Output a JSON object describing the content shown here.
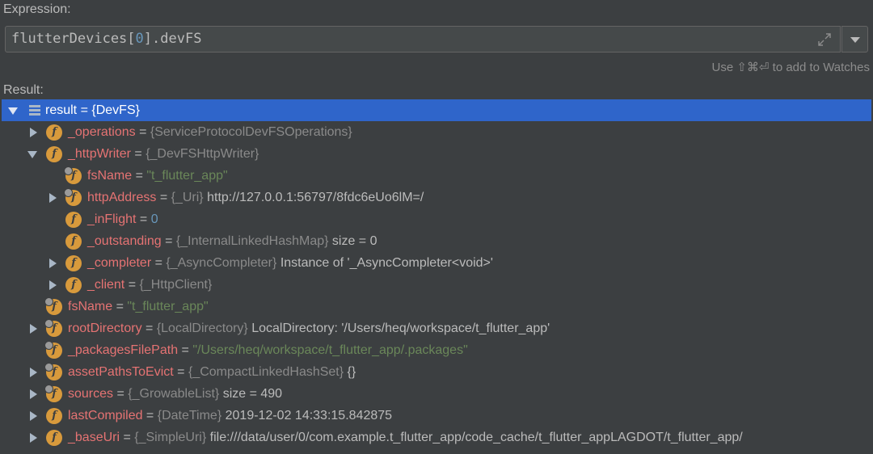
{
  "expression": {
    "label": "Expression:",
    "prefix": "flutterDevices[",
    "index": "0",
    "suffix": "].devFS",
    "hint": "Use ⇧⌘⏎ to add to Watches"
  },
  "result": {
    "label": "Result:",
    "rows": [
      {
        "indent": 0,
        "toggle": "expanded",
        "icon": "list",
        "name": "result",
        "type": "",
        "value": "= {DevFS}",
        "vclass": "val",
        "selected": true
      },
      {
        "indent": 1,
        "toggle": "collapsed",
        "icon": "field",
        "name": "_operations",
        "type": "{ServiceProtocolDevFSOperations}",
        "value": "",
        "vclass": "val"
      },
      {
        "indent": 1,
        "toggle": "expanded",
        "icon": "field",
        "name": "_httpWriter",
        "type": "{_DevFSHttpWriter}",
        "value": "",
        "vclass": "val"
      },
      {
        "indent": 2,
        "toggle": "none",
        "icon": "field-final",
        "name": "fsName",
        "type": "",
        "value": "\"t_flutter_app\"",
        "vclass": "str"
      },
      {
        "indent": 2,
        "toggle": "collapsed",
        "icon": "field-final",
        "name": "httpAddress",
        "type": "{_Uri}",
        "value": "http://127.0.0.1:56797/8fdc6eUo6lM=/",
        "vclass": "val"
      },
      {
        "indent": 2,
        "toggle": "none",
        "icon": "field",
        "name": "_inFlight",
        "type": "",
        "value": "0",
        "vclass": "number"
      },
      {
        "indent": 2,
        "toggle": "none",
        "icon": "field",
        "name": "_outstanding",
        "type": "{_InternalLinkedHashMap}",
        "value": "size = 0",
        "vclass": "val"
      },
      {
        "indent": 2,
        "toggle": "collapsed",
        "icon": "field",
        "name": "_completer",
        "type": "{_AsyncCompleter}",
        "value": "Instance of '_AsyncCompleter<void>'",
        "vclass": "val"
      },
      {
        "indent": 2,
        "toggle": "collapsed",
        "icon": "field",
        "name": "_client",
        "type": "{_HttpClient}",
        "value": "",
        "vclass": "val"
      },
      {
        "indent": 1,
        "toggle": "none",
        "icon": "field-final",
        "name": "fsName",
        "type": "",
        "value": "\"t_flutter_app\"",
        "vclass": "str"
      },
      {
        "indent": 1,
        "toggle": "collapsed",
        "icon": "field-final",
        "name": "rootDirectory",
        "type": "{LocalDirectory}",
        "value": "LocalDirectory: '/Users/heq/workspace/t_flutter_app'",
        "vclass": "val"
      },
      {
        "indent": 1,
        "toggle": "none",
        "icon": "field-final",
        "name": "_packagesFilePath",
        "type": "",
        "value": "\"/Users/heq/workspace/t_flutter_app/.packages\"",
        "vclass": "str"
      },
      {
        "indent": 1,
        "toggle": "collapsed",
        "icon": "field-final",
        "name": "assetPathsToEvict",
        "type": "{_CompactLinkedHashSet}",
        "value": "{}",
        "vclass": "val"
      },
      {
        "indent": 1,
        "toggle": "collapsed",
        "icon": "field-final",
        "name": "sources",
        "type": "{_GrowableList}",
        "value": "size = 490",
        "vclass": "val"
      },
      {
        "indent": 1,
        "toggle": "collapsed",
        "icon": "field",
        "name": "lastCompiled",
        "type": "{DateTime}",
        "value": "2019-12-02 14:33:15.842875",
        "vclass": "val"
      },
      {
        "indent": 1,
        "toggle": "collapsed",
        "icon": "field",
        "name": "_baseUri",
        "type": "{_SimpleUri}",
        "value": "file:///data/user/0/com.example.t_flutter_app/code_cache/t_flutter_appLAGDOT/t_flutter_app/",
        "vclass": "val"
      }
    ]
  },
  "icons": {
    "expand": "expand-arrows-icon",
    "dropdown": "chevron-down-icon",
    "field": "f",
    "list": "list-icon"
  },
  "colors": {
    "background": "#3c3f41",
    "selection": "#2f65ca",
    "field_name": "#e57373",
    "string": "#6a8759",
    "number": "#6897bb",
    "icon": "#d89a3c"
  }
}
